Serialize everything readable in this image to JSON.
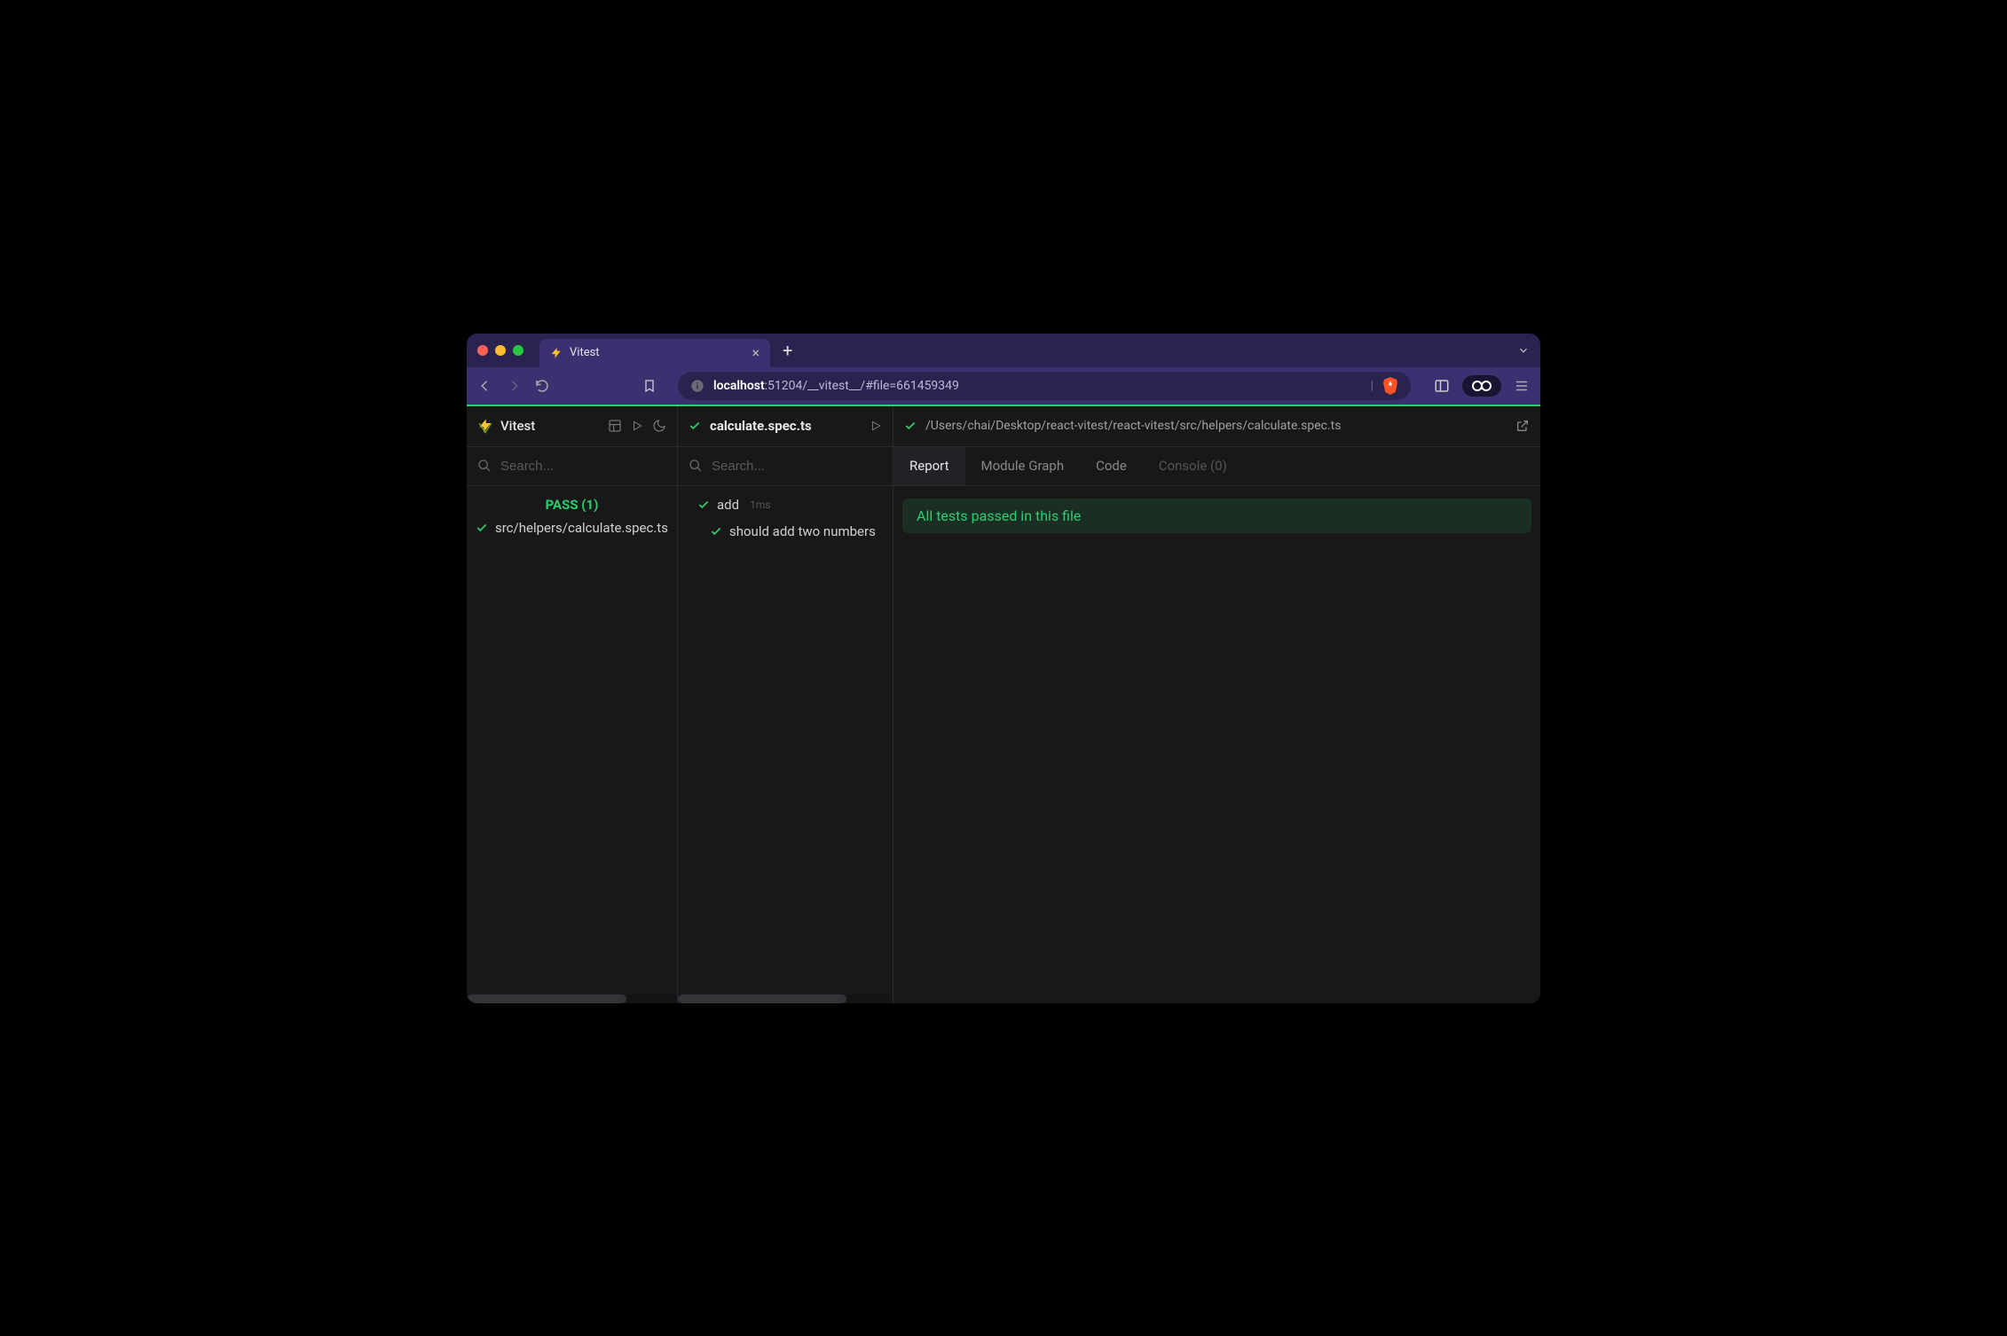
{
  "browser": {
    "tab_title": "Vitest",
    "url_host": "localhost",
    "url_rest": ":51204/__vitest__/#file=661459349"
  },
  "app": {
    "name": "Vitest",
    "left": {
      "search_placeholder": "Search...",
      "pass_label": "PASS (1)",
      "files": [
        "src/helpers/calculate.spec.ts"
      ]
    },
    "mid": {
      "file_title": "calculate.spec.ts",
      "search_placeholder": "Search...",
      "suites": [
        {
          "name": "add",
          "duration": "1ms",
          "tests": [
            "should add two numbers"
          ]
        }
      ]
    },
    "right": {
      "full_path": "/Users/chai/Desktop/react-vitest/react-vitest/src/helpers/calculate.spec.ts",
      "tabs": [
        {
          "label": "Report",
          "active": true
        },
        {
          "label": "Module Graph",
          "active": false
        },
        {
          "label": "Code",
          "active": false
        },
        {
          "label": "Console (0)",
          "active": false,
          "disabled": true
        }
      ],
      "banner": "All tests passed in this file"
    }
  }
}
